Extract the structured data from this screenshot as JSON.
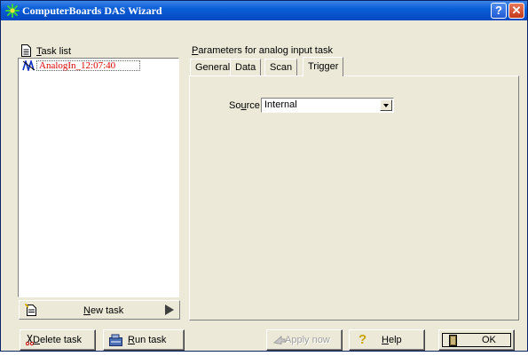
{
  "window": {
    "title": "ComputerBoards DAS Wizard",
    "help_glyph": "?",
    "close_glyph": "✕"
  },
  "tasklist": {
    "label_u": "T",
    "label_rest": "ask list",
    "items": [
      {
        "label": "AnalogIn_12:07:40"
      }
    ]
  },
  "new_task": {
    "label_u": "N",
    "label_rest": "ew task"
  },
  "parameters": {
    "title_u": "P",
    "title_rest": "arameters for analog input task",
    "tabs": [
      "General",
      "Data",
      "Scan",
      "Trigger"
    ],
    "selected_tab": "Trigger",
    "source": {
      "label_pre": "So",
      "label_u": "u",
      "label_post": "rce",
      "value": "Internal"
    }
  },
  "buttons": {
    "delete": {
      "u": "D",
      "rest": "elete task"
    },
    "run": {
      "u": "R",
      "rest": "un task"
    },
    "apply": {
      "label": "Apply now"
    },
    "help": {
      "u": "H",
      "rest": "elp"
    },
    "ok": {
      "label": "OK"
    }
  }
}
